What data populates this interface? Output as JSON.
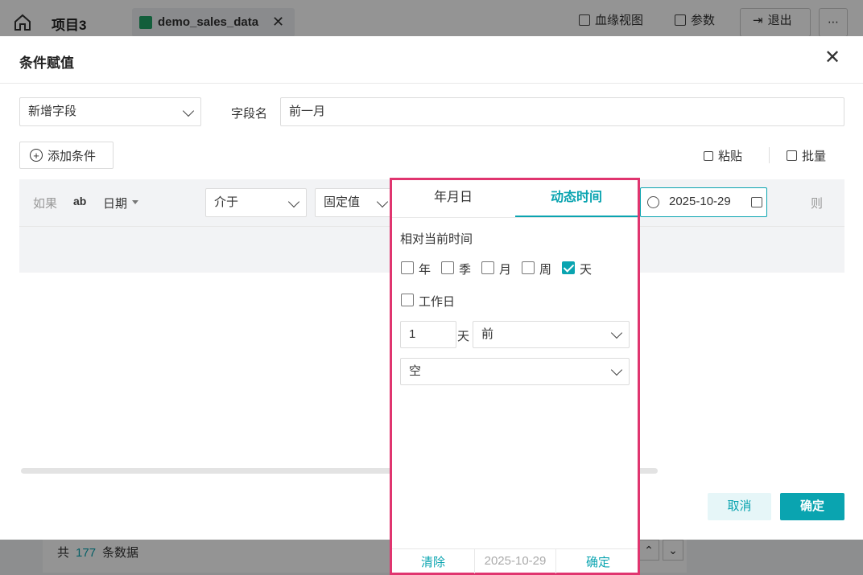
{
  "topbar": {
    "project": "项目3",
    "file_tab": "demo_sales_data",
    "lineage": "血缘视图",
    "params": "参数",
    "logout": "退出"
  },
  "background": {
    "count_prefix": "共",
    "count": "177",
    "count_suffix": "条数据"
  },
  "dialog": {
    "title": "条件赋值",
    "mode_select": "新增字段",
    "field_name_label": "字段名",
    "field_name_value": "前一月",
    "add_condition": "添加条件",
    "paste": "粘贴",
    "batch": "批量",
    "condition": {
      "if_label": "如果",
      "field_type": "ab",
      "field": "日期",
      "operator": "介于",
      "value_type": "固定值",
      "date_value": "2025-10-29",
      "then_label": "则"
    },
    "cancel": "取消",
    "confirm": "确定"
  },
  "popup": {
    "tabs": [
      "年月日",
      "动态时间"
    ],
    "active_tab": "动态时间",
    "relative_label": "相对当前时间",
    "units": [
      {
        "label": "年",
        "checked": false
      },
      {
        "label": "季",
        "checked": false
      },
      {
        "label": "月",
        "checked": false
      },
      {
        "label": "周",
        "checked": false
      },
      {
        "label": "天",
        "checked": true
      }
    ],
    "workday": {
      "label": "工作日",
      "checked": false
    },
    "offset_value": "1",
    "offset_unit": "天",
    "direction": "前",
    "boundary": "空",
    "footer": {
      "clear": "清除",
      "date": "2025-10-29",
      "confirm": "确定"
    }
  },
  "colors": {
    "accent": "#0aa4b0",
    "highlight": "#e0356f"
  }
}
